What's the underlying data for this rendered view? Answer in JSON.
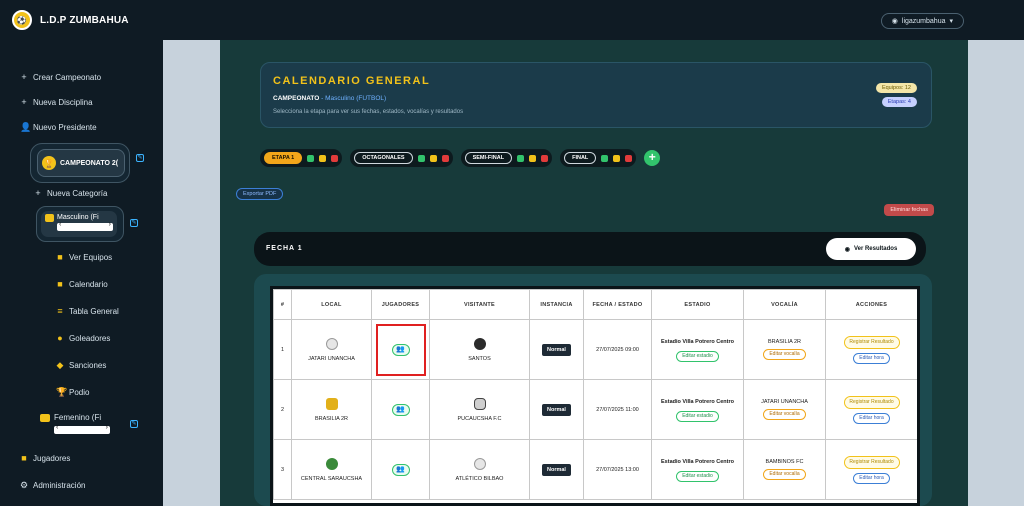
{
  "brand": {
    "name": "L.D.P ZUMBAHUA"
  },
  "user": {
    "name": "ligazumbahua"
  },
  "sidebar": {
    "crear_campeonato": "Crear Campeonato",
    "nueva_disciplina": "Nueva Disciplina",
    "nuevo_presidente": "Nuevo Presidente",
    "campeonato_label": "CAMPEONATO 2(",
    "nueva_categoria": "Nueva Categoría",
    "masculino_label": "Masculino (Fi",
    "ver_equipos": "Ver Equipos",
    "calendario": "Calendario",
    "tabla_general": "Tabla General",
    "goleadores": "Goleadores",
    "sanciones": "Sanciones",
    "podio": "Podio",
    "femenino_label": "Femenino (Fi",
    "jugadores": "Jugadores",
    "administracion": "Administración"
  },
  "header": {
    "title": "CALENDARIO GENERAL",
    "sub_bold": "CAMPEONATO",
    "sub_rest": " - Masculino (FUTBOL)",
    "desc": "Selecciona la etapa para ver sus fechas, estados, vocalías y resultados",
    "chip_equipos": "Equipos: 12",
    "chip_etapas": "Etapas: 4"
  },
  "stages": [
    {
      "label": "ETAPA 1"
    },
    {
      "label": "OCTAGONALES"
    },
    {
      "label": "SEMI-FINAL"
    },
    {
      "label": "FINAL"
    }
  ],
  "add_stage": "+",
  "export_pdf": "Exportar PDF",
  "danger_button": "Eliminar fechas",
  "fecha": {
    "label": "FECHA 1",
    "ver_resultados": "Ver Resultados"
  },
  "table": {
    "headers": [
      "#",
      "LOCAL",
      "JUGADORES",
      "VISITANTE",
      "INSTANCIA",
      "FECHA / ESTADO",
      "ESTADIO",
      "VOCALÍA",
      "ACCIONES"
    ],
    "rows": [
      {
        "num": "1",
        "local": "JATARI UNANCHA",
        "visitante": "SANTOS",
        "instancia": "Normal",
        "fecha": "27/07/2025 09:00",
        "estadio": "Estadio Villa Potrero Centro",
        "editar_estadio": "Editar estadio",
        "vocalia": "BRASILIA 2R",
        "editar_vocalia": "Editar vocalía",
        "registrar": "Registrar Resultado",
        "editar_hora": "Editar hora"
      },
      {
        "num": "2",
        "local": "BRASILIA 2R",
        "visitante": "PUCAUCSHA F.C",
        "instancia": "Normal",
        "fecha": "27/07/2025 11:00",
        "estadio": "Estadio Villa Potrero Centro",
        "editar_estadio": "Editar estadio",
        "vocalia": "JATARI UNANCHA",
        "editar_vocalia": "Editar vocalía",
        "registrar": "Registrar Resultado",
        "editar_hora": "Editar hora"
      },
      {
        "num": "3",
        "local": "CENTRAL SARAUCSHA",
        "visitante": "ATLÉTICO BILBAO",
        "instancia": "Normal",
        "fecha": "27/07/2025 13:00",
        "estadio": "Estadio Villa Potrero Centro",
        "editar_estadio": "Editar estadio",
        "vocalia": "BAMBINOS FC",
        "editar_vocalia": "Editar vocalía",
        "registrar": "Registrar Resultado",
        "editar_hora": "Editar hora"
      }
    ]
  },
  "colors": {
    "sidebar_bg": "#0f1b24",
    "main_bg": "#173a3a",
    "accent_yellow": "#f2c21a",
    "accent_green": "#32c36c",
    "highlight_red": "#e02020"
  }
}
